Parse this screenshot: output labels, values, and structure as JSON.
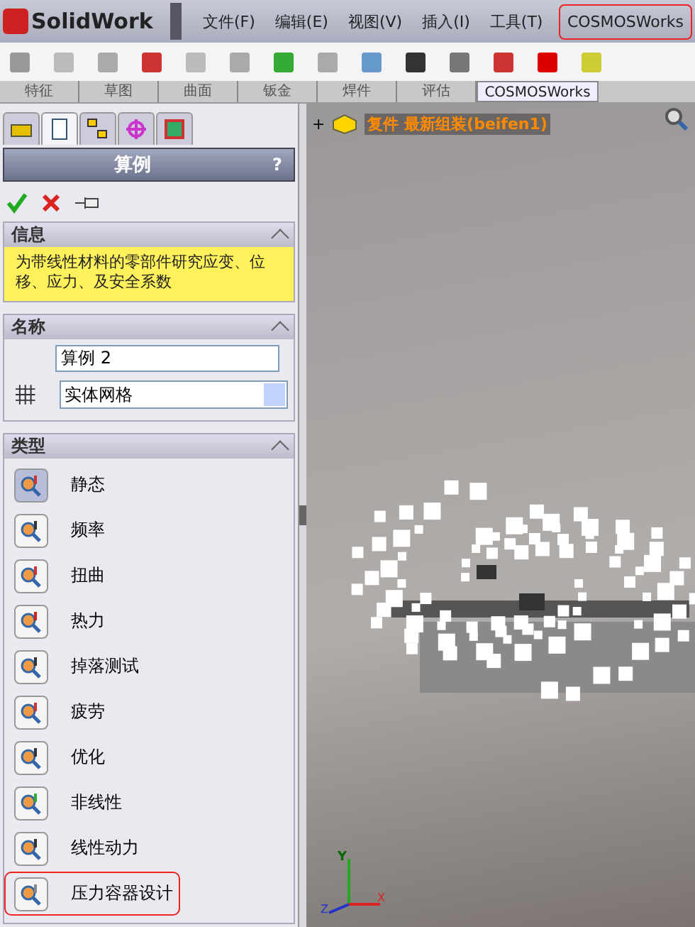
{
  "app": {
    "logo_text": "SolidWork"
  },
  "menu": [
    {
      "label": "文件(F)",
      "highlighted": false
    },
    {
      "label": "编辑(E)",
      "highlighted": false
    },
    {
      "label": "视图(V)",
      "highlighted": false
    },
    {
      "label": "插入(I)",
      "highlighted": false
    },
    {
      "label": "工具(T)",
      "highlighted": false
    },
    {
      "label": "COSMOSWorks",
      "highlighted": true
    }
  ],
  "command_tabs": [
    {
      "label": "特征",
      "selected": false
    },
    {
      "label": "草图",
      "selected": false
    },
    {
      "label": "曲面",
      "selected": false
    },
    {
      "label": "钣金",
      "selected": false
    },
    {
      "label": "焊件",
      "selected": false
    },
    {
      "label": "评估",
      "selected": false
    },
    {
      "label": "COSMOSWorks",
      "selected": true
    }
  ],
  "panel_tabs": [
    {
      "kind": "part",
      "selected": false
    },
    {
      "kind": "property",
      "selected": true
    },
    {
      "kind": "config",
      "selected": false
    },
    {
      "kind": "target",
      "selected": false
    },
    {
      "kind": "cube",
      "selected": false
    }
  ],
  "panel": {
    "title": "算例",
    "help": "?",
    "info": {
      "heading": "信息",
      "message": "为带线性材料的零部件研究应变、位移、应力、及安全系数"
    },
    "name": {
      "heading": "名称",
      "value": "算例 2",
      "mesh": "实体网格"
    },
    "type": {
      "heading": "类型",
      "items": [
        {
          "label": "静态",
          "selected": true,
          "highlighted": false
        },
        {
          "label": "频率",
          "selected": false,
          "highlighted": false
        },
        {
          "label": "扭曲",
          "selected": false,
          "highlighted": false
        },
        {
          "label": "热力",
          "selected": false,
          "highlighted": false
        },
        {
          "label": "掉落测试",
          "selected": false,
          "highlighted": false
        },
        {
          "label": "疲劳",
          "selected": false,
          "highlighted": false
        },
        {
          "label": "优化",
          "selected": false,
          "highlighted": false
        },
        {
          "label": "非线性",
          "selected": false,
          "highlighted": false
        },
        {
          "label": "线性动力",
          "selected": false,
          "highlighted": false
        },
        {
          "label": "压力容器设计",
          "selected": false,
          "highlighted": true
        }
      ]
    }
  },
  "viewport": {
    "expand": "+",
    "tree_item": "复件 最新组装(beifen1)",
    "axes": [
      "Y",
      "X",
      "Z"
    ]
  }
}
